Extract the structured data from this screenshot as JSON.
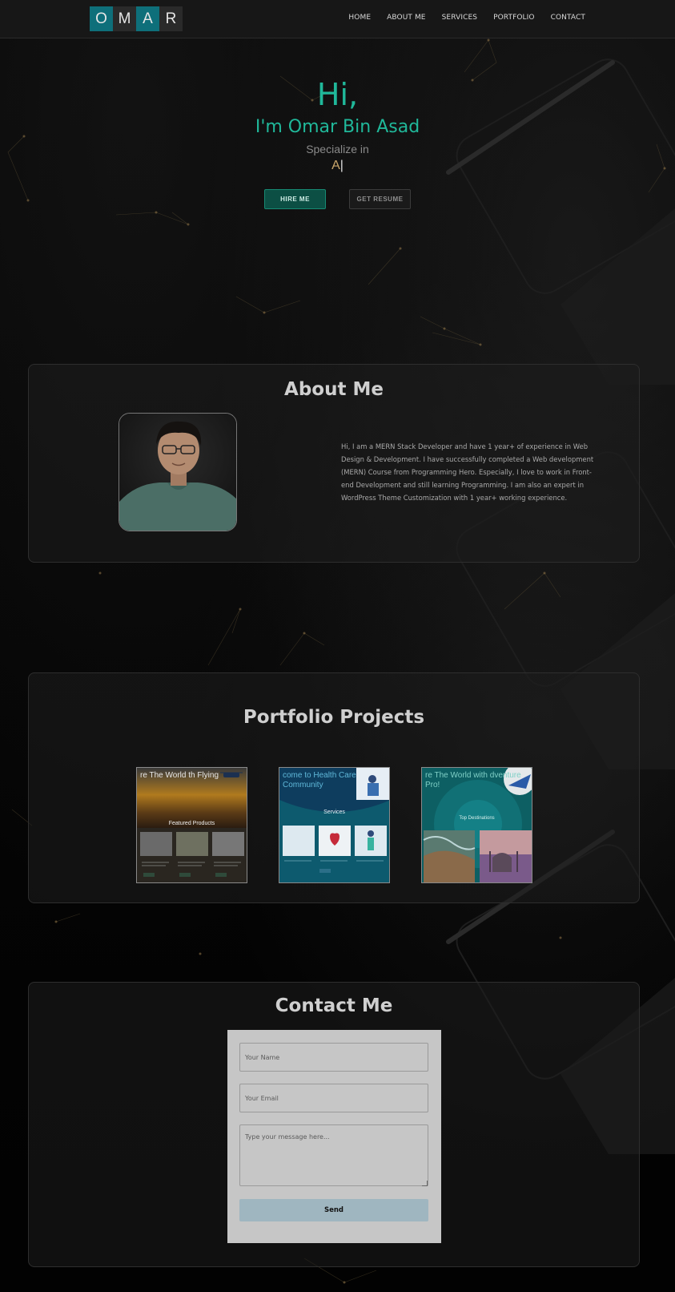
{
  "nav": {
    "logo_letters": [
      "O",
      "M",
      "A",
      "R"
    ],
    "links": [
      "HOME",
      "ABOUT ME",
      "SERVICES",
      "PORTFOLIO",
      "CONTACT"
    ]
  },
  "hero": {
    "greeting": "Hi,",
    "name": "I'm Omar Bin Asad",
    "specialize": "Specialize in",
    "typed": "A",
    "hire_label": "HIRE ME",
    "resume_label": "GET RESUME"
  },
  "about": {
    "title": "About Me",
    "text": "Hi, I am a MERN Stack Developer and have 1 year+ of experience in Web Design & Development. I have successfully completed a Web development (MERN) Course from Programming Hero. Especially, I love to work in Front-end Development and still learning Programming. I am also an expert in WordPress Theme Customization with 1 year+ working experience."
  },
  "portfolio": {
    "title": "Portfolio Projects",
    "projects": [
      {
        "heading": "re The World th Flying",
        "sub": "Featured Products"
      },
      {
        "heading": "come to Health Care Community",
        "sub": "Services"
      },
      {
        "heading": "re The World with dventure Pro!",
        "sub": "Top Destinations"
      }
    ]
  },
  "contact": {
    "title": "Contact Me",
    "name_placeholder": "Your Name",
    "email_placeholder": "Your Email",
    "message_placeholder": "Type your message here...",
    "send_label": "Send"
  },
  "colors": {
    "accent": "#20b89a",
    "logo_teal": "#0e6f7a",
    "typed": "#c9a66b"
  }
}
